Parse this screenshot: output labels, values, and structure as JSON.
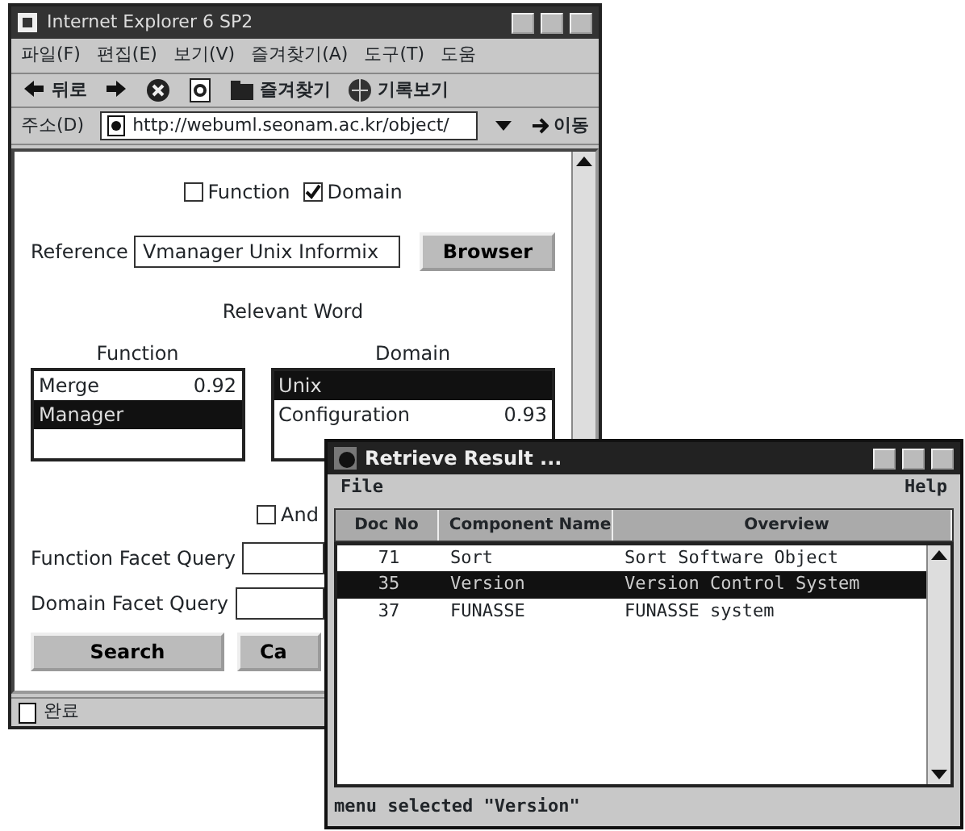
{
  "browser": {
    "title": "Internet Explorer 6 SP2",
    "menu": [
      "파일(F)",
      "편집(E)",
      "보기(V)",
      "즐겨찾기(A)",
      "도구(T)",
      "도움"
    ],
    "toolbar": [
      "뒤로",
      "즐겨찾기",
      "기록보기"
    ],
    "address": {
      "label": "주소(D)",
      "value": "http://webuml.seonam.ac.kr/object/",
      "go": "이동"
    },
    "status": "완료"
  },
  "form": {
    "facets": [
      {
        "label": "Function",
        "checked": false
      },
      {
        "label": "Domain",
        "checked": true
      }
    ],
    "reference": {
      "label": "Reference",
      "value": "Vmanager Unix Informix",
      "button": "Browser"
    },
    "relevant_title": "Relevant Word",
    "lists": [
      {
        "title": "Function",
        "items": [
          {
            "word": "Merge",
            "score": "0.92",
            "selected": false
          },
          {
            "word": "Manager",
            "selected": true
          }
        ]
      },
      {
        "title": "Domain",
        "items": [
          {
            "word": "Unix",
            "selected": true
          },
          {
            "word": "Configuration",
            "score": "0.93",
            "selected": false
          }
        ]
      }
    ],
    "and": {
      "label": "And",
      "checked": false
    },
    "queries": [
      {
        "label": "Function Facet Query"
      },
      {
        "label": "Domain Facet Query"
      }
    ],
    "buttons": [
      "Search",
      "Ca"
    ]
  },
  "result": {
    "title": "Retrieve Result ...",
    "menu": [
      "File",
      "Help"
    ],
    "columns": [
      "Doc No",
      "Component Name",
      "Overview"
    ],
    "rows": [
      {
        "cells": [
          "71",
          "Sort",
          "Sort Software Object"
        ],
        "selected": false
      },
      {
        "cells": [
          "35",
          "Version",
          "Version Control System"
        ],
        "selected": true
      },
      {
        "cells": [
          "37",
          "FUNASSE",
          "FUNASSE system"
        ],
        "selected": false
      }
    ],
    "status": "menu selected \"Version\""
  }
}
